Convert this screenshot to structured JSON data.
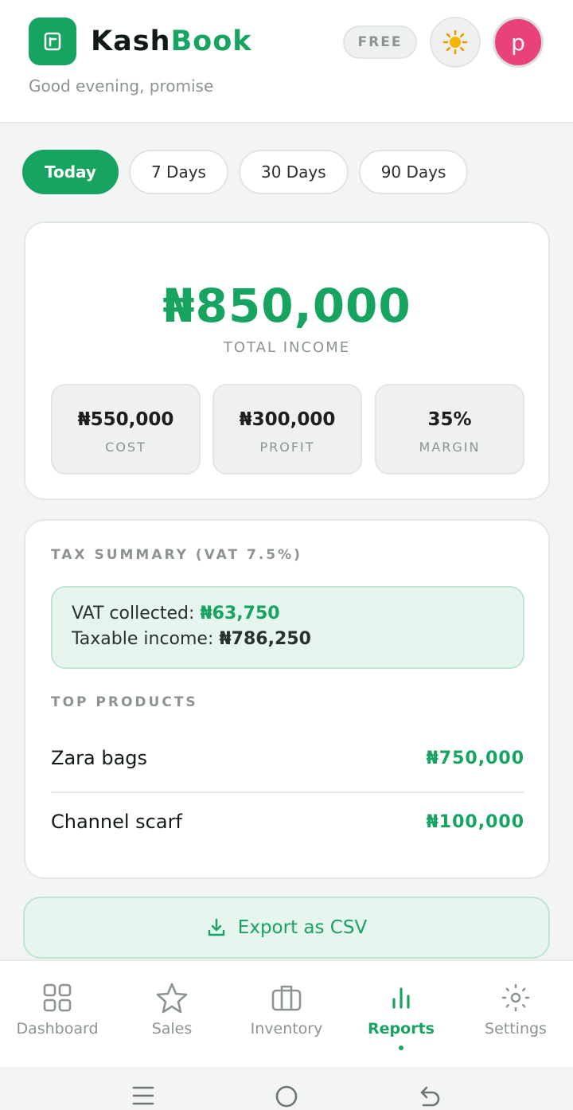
{
  "header": {
    "brand_part1": "Kash",
    "brand_part2": "Book",
    "greeting": "Good evening, promise",
    "plan_badge": "FREE",
    "theme_icon": "sun-icon",
    "avatar_initial": "p",
    "avatar_color": "#e8417c"
  },
  "tabs": [
    {
      "label": "Today",
      "active": true
    },
    {
      "label": "7 Days",
      "active": false
    },
    {
      "label": "30 Days",
      "active": false
    },
    {
      "label": "90 Days",
      "active": false
    }
  ],
  "summary": {
    "total_income": "₦850,000",
    "total_income_label": "TOTAL INCOME",
    "stats": [
      {
        "value": "₦550,000",
        "label": "COST"
      },
      {
        "value": "₦300,000",
        "label": "PROFIT"
      },
      {
        "value": "35%",
        "label": "MARGIN"
      }
    ]
  },
  "tax": {
    "title": "TAX SUMMARY (VAT 7.5%)",
    "vat_collected_label": "VAT collected: ",
    "vat_collected_value": "₦63,750",
    "taxable_income_label": "Taxable income: ",
    "taxable_income_value": "₦786,250"
  },
  "top_products": {
    "title": "TOP PRODUCTS",
    "items": [
      {
        "name": "Zara bags",
        "amount": "₦750,000"
      },
      {
        "name": "Channel scarf",
        "amount": "₦100,000"
      }
    ]
  },
  "export": {
    "label": "Export as CSV",
    "icon": "download-icon"
  },
  "bottom_nav": [
    {
      "label": "Dashboard",
      "icon": "grid-icon",
      "active": false
    },
    {
      "label": "Sales",
      "icon": "star-icon",
      "active": false
    },
    {
      "label": "Inventory",
      "icon": "briefcase-icon",
      "active": false
    },
    {
      "label": "Reports",
      "icon": "bar-chart-icon",
      "active": true
    },
    {
      "label": "Settings",
      "icon": "gear-icon",
      "active": false
    }
  ],
  "colors": {
    "brand_green": "#17a360",
    "muted_text": "#8c948f"
  }
}
